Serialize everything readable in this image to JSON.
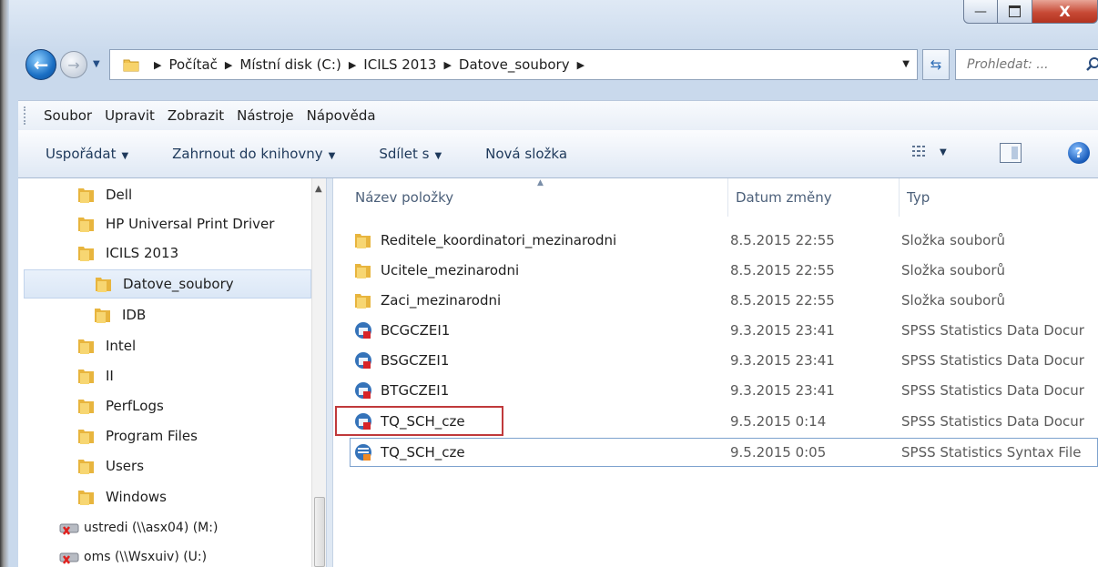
{
  "window": {
    "min_glyph": "—",
    "max_glyph": "▫",
    "close_glyph": "X"
  },
  "address": {
    "crumbs": [
      "Počítač",
      "Místní disk (C:)",
      "ICILS 2013",
      "Datove_soubory"
    ],
    "search_placeholder": "Prohledat: ..."
  },
  "menu": [
    "Soubor",
    "Upravit",
    "Zobrazit",
    "Nástroje",
    "Nápověda"
  ],
  "commands": {
    "organize": "Uspořádat",
    "include_library": "Zahrnout do knihovny",
    "share": "Sdílet s",
    "new_folder": "Nová složka"
  },
  "tree": [
    {
      "label": "Dell",
      "icon": "folder-icon"
    },
    {
      "label": "HP Universal Print Driver",
      "icon": "folder-icon"
    },
    {
      "label": "ICILS 2013",
      "icon": "folder-icon"
    },
    {
      "label": "Datove_soubory",
      "icon": "folder-icon",
      "selected": true
    },
    {
      "label": "IDB",
      "icon": "folder-icon"
    },
    {
      "label": "Intel",
      "icon": "folder-icon"
    },
    {
      "label": "II",
      "icon": "folder-icon"
    },
    {
      "label": "PerfLogs",
      "icon": "folder-icon"
    },
    {
      "label": "Program Files",
      "icon": "folder-icon"
    },
    {
      "label": "Users",
      "icon": "folder-icon"
    },
    {
      "label": "Windows",
      "icon": "folder-icon"
    },
    {
      "label": "ustredi (\\\\asx04) (M:)",
      "icon": "disconnected-drive-icon"
    },
    {
      "label": "oms (\\\\Wsxuiv) (U:)",
      "icon": "disconnected-drive-icon"
    }
  ],
  "columns": {
    "name": "Název položky",
    "date": "Datum změny",
    "type": "Typ"
  },
  "files": [
    {
      "name": "Reditele_koordinatori_mezinarodni",
      "date": "8.5.2015 22:55",
      "type": "Složka souborů",
      "icon": "folder-icon"
    },
    {
      "name": "Ucitele_mezinarodni",
      "date": "8.5.2015 22:55",
      "type": "Složka souborů",
      "icon": "folder-icon"
    },
    {
      "name": "Zaci_mezinarodni",
      "date": "8.5.2015 22:55",
      "type": "Složka souborů",
      "icon": "folder-icon"
    },
    {
      "name": "BCGCZEI1",
      "date": "9.3.2015 23:41",
      "type": "SPSS Statistics Data Docur",
      "icon": "spss-data-icon"
    },
    {
      "name": "BSGCZEI1",
      "date": "9.3.2015 23:41",
      "type": "SPSS Statistics Data Docur",
      "icon": "spss-data-icon"
    },
    {
      "name": "BTGCZEI1",
      "date": "9.3.2015 23:41",
      "type": "SPSS Statistics Data Docur",
      "icon": "spss-data-icon"
    },
    {
      "name": "TQ_SCH_cze",
      "date": "9.5.2015 0:14",
      "type": "SPSS Statistics Data Docur",
      "icon": "spss-data-icon"
    },
    {
      "name": "TQ_SCH_cze",
      "date": "9.5.2015 0:05",
      "type": "SPSS Statistics Syntax File",
      "icon": "spss-syntax-icon"
    }
  ]
}
